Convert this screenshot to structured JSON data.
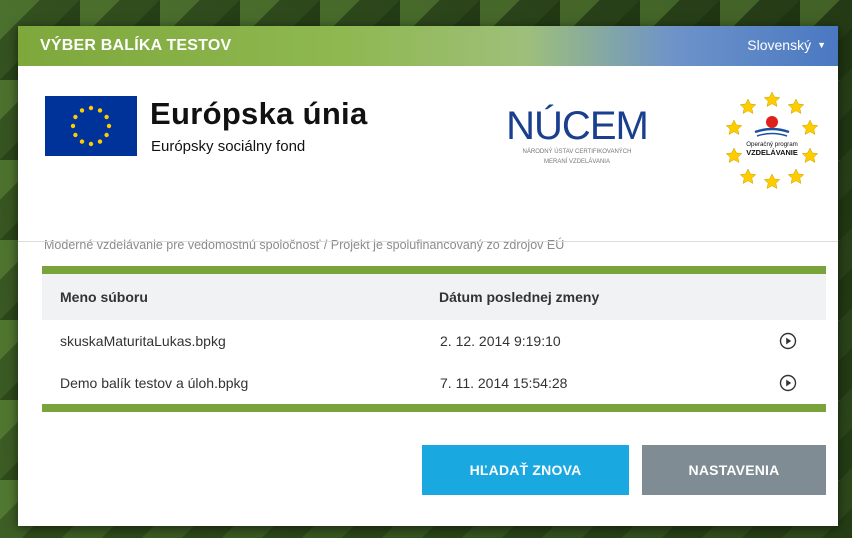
{
  "window": {
    "title": "VÝBER BALÍKA TESTOV",
    "language": "Slovenský"
  },
  "logos": {
    "eu_title": "Európska únia",
    "eu_subtitle": "Európsky sociálny fond",
    "nucem_name": "NÚCEM",
    "nucem_line1": "NÁRODNÝ ÚSTAV CERTIFIKOVANÝCH",
    "nucem_line2": "MERANÍ VZDELÁVANIA",
    "op_line1": "Operačný program",
    "op_line2": "VZDELÁVANIE"
  },
  "tagline": "Moderné vzdelávanie pre vedomostnú spoločnosť / Projekt je spolufinancovaný zo zdrojov EÚ",
  "table": {
    "columns": [
      "Meno súboru",
      "Dátum poslednej zmeny"
    ],
    "rows": [
      {
        "name": "skuskaMaturitaLukas.bpkg",
        "date": "2. 12. 2014 9:19:10"
      },
      {
        "name": "Demo balík testov a úloh.bpkg",
        "date": "7. 11. 2014 15:54:28"
      }
    ]
  },
  "buttons": {
    "search": "HĽADAŤ ZNOVA",
    "settings": "NASTAVENIA"
  },
  "colors": {
    "accent_green": "#7aa33b",
    "button_blue": "#1aa8e0",
    "button_gray": "#7f8c94",
    "eu_blue": "#003399",
    "eu_star": "#ffcc00"
  }
}
